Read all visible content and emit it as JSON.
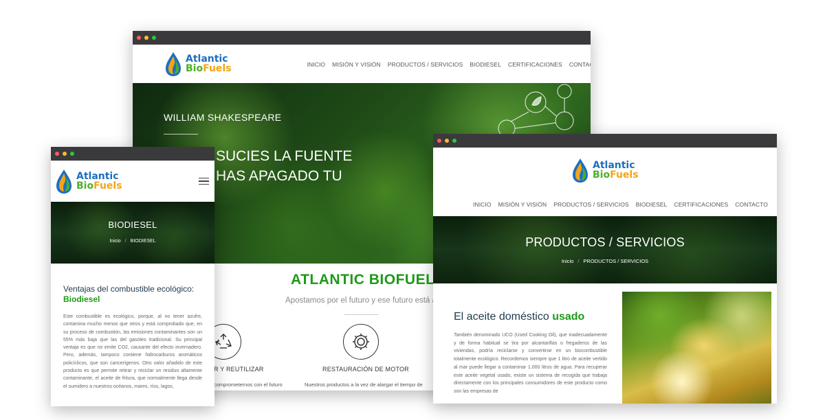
{
  "brand": {
    "line1": "Atlantic",
    "line2_prefix": "Bio",
    "line2_suffix": "Fuels"
  },
  "nav": [
    "INICIO",
    "MISIÓN Y VISIÓN",
    "PRODUCTOS / SERVICIOS",
    "BIODIESEL",
    "CERTIFICACIONES",
    "CONTACTO"
  ],
  "center": {
    "hero_kicker": "WILLIAM SHAKESPEARE",
    "hero_line1": "SUCIES LA FUENTE",
    "hero_line2": "HAS APAGADO TU",
    "heading": "ATLANTIC BIOFUELS",
    "subheading": "Apostamos por el futuro y ese futuro está aqu",
    "services": [
      {
        "title": "R Y REUTILIZAR",
        "text": "comprometernos con el futuro",
        "icon": "recycle-icon"
      },
      {
        "title": "RESTAURACIÓN DE MOTOR",
        "text": "Nuestros productos a la vez de alargar el tiempo de",
        "icon": "gear-icon"
      }
    ]
  },
  "left": {
    "page_title": "BIODIESEL",
    "crumb_home": "Inicio",
    "crumb_sep": "/",
    "crumb_current": "BIODIESEL",
    "heading": "Ventajas del combustible ecológico:",
    "heading_green": "Biodiesel",
    "paragraph": "Este combustible es ecológico, porque, al no tener azufre, contamina mucho menos que otros y está comprobado que, en su proceso de combustión, las emisiones contaminantes son un 55% más baja que las del gasóleo tradicional. Su principal ventaja es que no emite CO2, causante del efecto invernadero. Pero, además, tampoco contiene hidrocarburos aromáticos policíclicos, que son cancerígenos. Otro valor añadido de este producto es que permite retirar y reciclar un residuo altamente contaminante, el aceite de fritura, que normalmente llega desde el sumidero a nuestros océanos, mares, ríos, lagos,"
  },
  "right": {
    "page_title": "PRODUCTOS / SERVICIOS",
    "crumb_home": "Inicio",
    "crumb_sep": "/",
    "crumb_current": "PRODUCTOS / SERVICIOS",
    "heading": "El aceite doméstico",
    "heading_green": "usado",
    "paragraph": "También denominado UCO (Used Cooking Oil), que inadecuadamente y de forma habitual se tira por alcantarillas o fregaderos de las viviendas, podría reciclarse y convertirse en un biocombustible totalmente ecológico. Recordemos siempre que 1 litro de aceite vertido al mar puede llegar a contaminar 1.000 litros de agua. Para recuperar este aceite vegetal usado, existe un sistema de recogida que trabaja directamente con los principales consumidores de este producto como son las empresas de"
  }
}
